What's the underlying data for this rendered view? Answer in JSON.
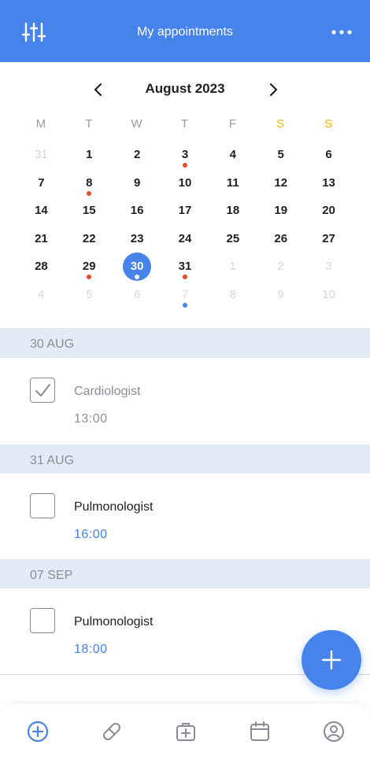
{
  "header": {
    "title": "My appointments",
    "filter_icon": "sliders-icon",
    "more_icon": "more-horizontal-icon"
  },
  "calendar": {
    "month_label": "August 2023",
    "weekdays": [
      "M",
      "T",
      "W",
      "T",
      "F",
      "S",
      "S"
    ],
    "weeks": [
      [
        {
          "d": "31",
          "muted": true
        },
        {
          "d": "1"
        },
        {
          "d": "2"
        },
        {
          "d": "3",
          "dot": "red"
        },
        {
          "d": "4"
        },
        {
          "d": "5"
        },
        {
          "d": "6"
        }
      ],
      [
        {
          "d": "7"
        },
        {
          "d": "8",
          "dot": "red"
        },
        {
          "d": "9"
        },
        {
          "d": "10"
        },
        {
          "d": "11"
        },
        {
          "d": "12"
        },
        {
          "d": "13"
        }
      ],
      [
        {
          "d": "14"
        },
        {
          "d": "15"
        },
        {
          "d": "16"
        },
        {
          "d": "17"
        },
        {
          "d": "18"
        },
        {
          "d": "19"
        },
        {
          "d": "20"
        }
      ],
      [
        {
          "d": "21"
        },
        {
          "d": "22"
        },
        {
          "d": "23"
        },
        {
          "d": "24"
        },
        {
          "d": "25"
        },
        {
          "d": "26"
        },
        {
          "d": "27"
        }
      ],
      [
        {
          "d": "28"
        },
        {
          "d": "29",
          "dot": "red"
        },
        {
          "d": "30",
          "selected": true,
          "dot": "white"
        },
        {
          "d": "31",
          "dot": "red"
        },
        {
          "d": "1",
          "muted": true
        },
        {
          "d": "2",
          "muted": true
        },
        {
          "d": "3",
          "muted": true
        }
      ],
      [
        {
          "d": "4",
          "muted": true
        },
        {
          "d": "5",
          "muted": true
        },
        {
          "d": "6",
          "muted": true
        },
        {
          "d": "7",
          "muted": true,
          "dot": "blue"
        },
        {
          "d": "8",
          "muted": true
        },
        {
          "d": "9",
          "muted": true
        },
        {
          "d": "10",
          "muted": true
        }
      ]
    ]
  },
  "sections": [
    {
      "date": "30 AUG",
      "appointment": {
        "name": "Cardiologist",
        "time": "13:00",
        "done": true
      }
    },
    {
      "date": "31 AUG",
      "appointment": {
        "name": "Pulmonologist",
        "time": "16:00",
        "done": false
      }
    },
    {
      "date": "07 SEP",
      "appointment": {
        "name": "Pulmonologist",
        "time": "18:00",
        "done": false
      }
    }
  ],
  "fab": {
    "icon": "plus-icon"
  },
  "tabbar": {
    "items": [
      {
        "icon": "plus-circle-icon",
        "active": true
      },
      {
        "icon": "pill-icon",
        "active": false
      },
      {
        "icon": "medical-kit-icon",
        "active": false
      },
      {
        "icon": "calendar-icon",
        "active": false
      },
      {
        "icon": "profile-icon",
        "active": false
      }
    ]
  },
  "colors": {
    "primary": "#4683ea",
    "weekend": "#f0b400",
    "marker_red": "#e84b2a",
    "section_bg": "#e2ebf6"
  }
}
